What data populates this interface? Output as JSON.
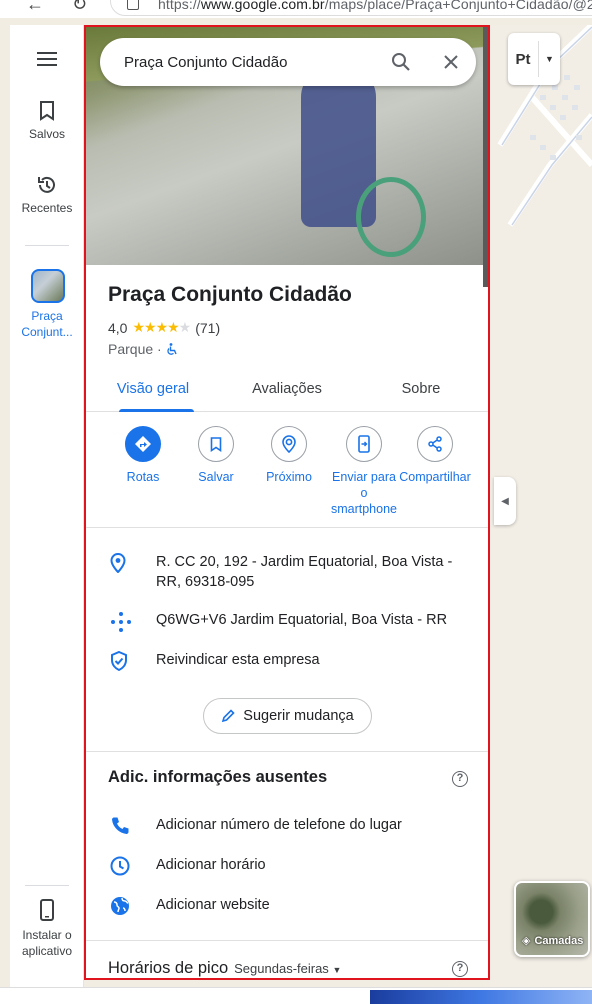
{
  "browser": {
    "url_prefix": "https://",
    "url_host": "www.google.com.br",
    "url_rest": "/maps/place/Praça+Conjunto+Cidadão/@2"
  },
  "rail": {
    "menu_icon": "menu-icon",
    "saved_label": "Salvos",
    "recent_label": "Recentes",
    "place_label": "Praça Conjunt...",
    "install_label": "Instalar o aplicativo"
  },
  "search": {
    "query": "Praça Conjunto Cidadão"
  },
  "place": {
    "name": "Praça Conjunto Cidadão",
    "rating": "4,0",
    "rating_value": 4,
    "review_count": "(71)",
    "category": "Parque ·"
  },
  "tabs": [
    "Visão geral",
    "Avaliações",
    "Sobre"
  ],
  "actions": [
    {
      "label": "Rotas",
      "icon": "directions-icon"
    },
    {
      "label": "Salvar",
      "icon": "bookmark-icon"
    },
    {
      "label": "Próximo",
      "icon": "nearby-icon"
    },
    {
      "label": "Enviar para o smartphone",
      "icon": "send-to-phone-icon"
    },
    {
      "label": "Compartilhar",
      "icon": "share-icon"
    }
  ],
  "info": {
    "address": "R. CC 20, 192 - Jardim Equatorial, Boa Vista - RR, 69318-095",
    "plus_code": "Q6WG+V6 Jardim Equatorial, Boa Vista - RR",
    "claim": "Reivindicar esta empresa"
  },
  "suggest_label": "Sugerir mudança",
  "missing": {
    "title": "Adic. informações ausentes",
    "phone": "Adicionar número de telefone do lugar",
    "hours": "Adicionar horário",
    "website": "Adicionar website"
  },
  "peak": {
    "title": "Horários de pico",
    "day": "Segundas-feiras"
  },
  "map": {
    "type_label": "Pt",
    "layers_label": "Camadas"
  },
  "colors": {
    "accent": "#1a73e8",
    "star": "#fbbc04",
    "highlight_border": "#e0141f"
  }
}
